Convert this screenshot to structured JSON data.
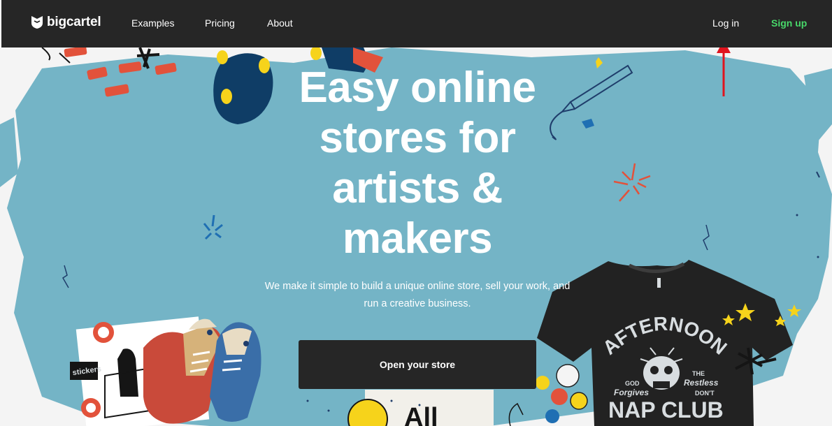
{
  "header": {
    "brand": "bigcartel",
    "nav": [
      "Examples",
      "Pricing",
      "About"
    ],
    "login": "Log in",
    "signup": "Sign up"
  },
  "hero": {
    "headline_lines": [
      "Easy online",
      "stores for",
      "artists &",
      "makers"
    ],
    "subtext_lines": [
      "We make it simple to build a unique online store, sell your work, and",
      "run a creative business."
    ],
    "cta_label": "Open your store"
  },
  "artwork": {
    "tshirt_top": "AFTERNOON",
    "tshirt_bottom": "NAP CLUB",
    "tshirt_small_left": [
      "GOD",
      "Forgives"
    ],
    "tshirt_small_right": [
      "THE",
      "Restless",
      "DON'T"
    ],
    "poster_text": "All",
    "sticker_text": "stickers"
  },
  "colors": {
    "header_bg": "#262626",
    "signup": "#48d86a",
    "hero_blue": "#74b4c6",
    "cta_bg": "#262626",
    "annotation_arrow": "#e0141e"
  }
}
